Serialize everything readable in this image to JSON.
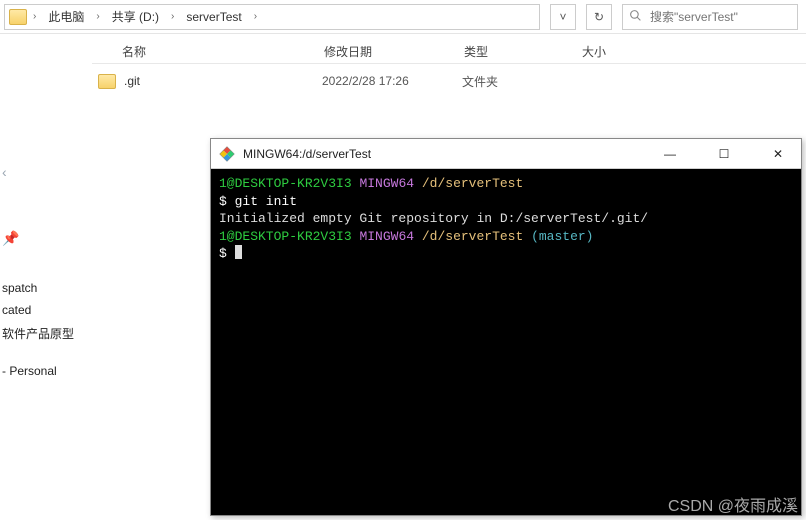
{
  "explorer": {
    "breadcrumb": [
      "此电脑",
      "共享 (D:)",
      "serverTest"
    ],
    "dropdown_hint": "v",
    "refresh_hint": "↻",
    "search_placeholder": "搜索\"serverTest\"",
    "columns": {
      "name": "名称",
      "date": "修改日期",
      "type": "类型",
      "size": "大小"
    },
    "rows": [
      {
        "name": ".git",
        "date": "2022/2/28 17:26",
        "type": "文件夹",
        "size": ""
      }
    ],
    "sidebar": {
      "items": [
        "spatch",
        "cated",
        "软件产品原型",
        "",
        "- Personal"
      ]
    }
  },
  "terminal": {
    "title": "MINGW64:/d/serverTest",
    "lines": [
      {
        "segments": [
          {
            "cls": "c-green",
            "text": "1@DESKTOP-KR2V3I3 "
          },
          {
            "cls": "c-purple",
            "text": "MINGW64 "
          },
          {
            "cls": "c-yellow",
            "text": "/d/serverTest"
          }
        ]
      },
      {
        "segments": [
          {
            "cls": "c-white",
            "text": "$ git init"
          }
        ]
      },
      {
        "segments": [
          {
            "cls": "",
            "text": "Initialized empty Git repository in D:/serverTest/.git/"
          }
        ]
      },
      {
        "segments": [
          {
            "cls": "",
            "text": ""
          }
        ]
      },
      {
        "segments": [
          {
            "cls": "c-green",
            "text": "1@DESKTOP-KR2V3I3 "
          },
          {
            "cls": "c-purple",
            "text": "MINGW64 "
          },
          {
            "cls": "c-yellow",
            "text": "/d/serverTest "
          },
          {
            "cls": "c-cyan",
            "text": "(master)"
          }
        ]
      },
      {
        "segments": [
          {
            "cls": "c-white",
            "text": "$ "
          }
        ],
        "cursor": true
      }
    ]
  },
  "watermark": "CSDN @夜雨成溪"
}
